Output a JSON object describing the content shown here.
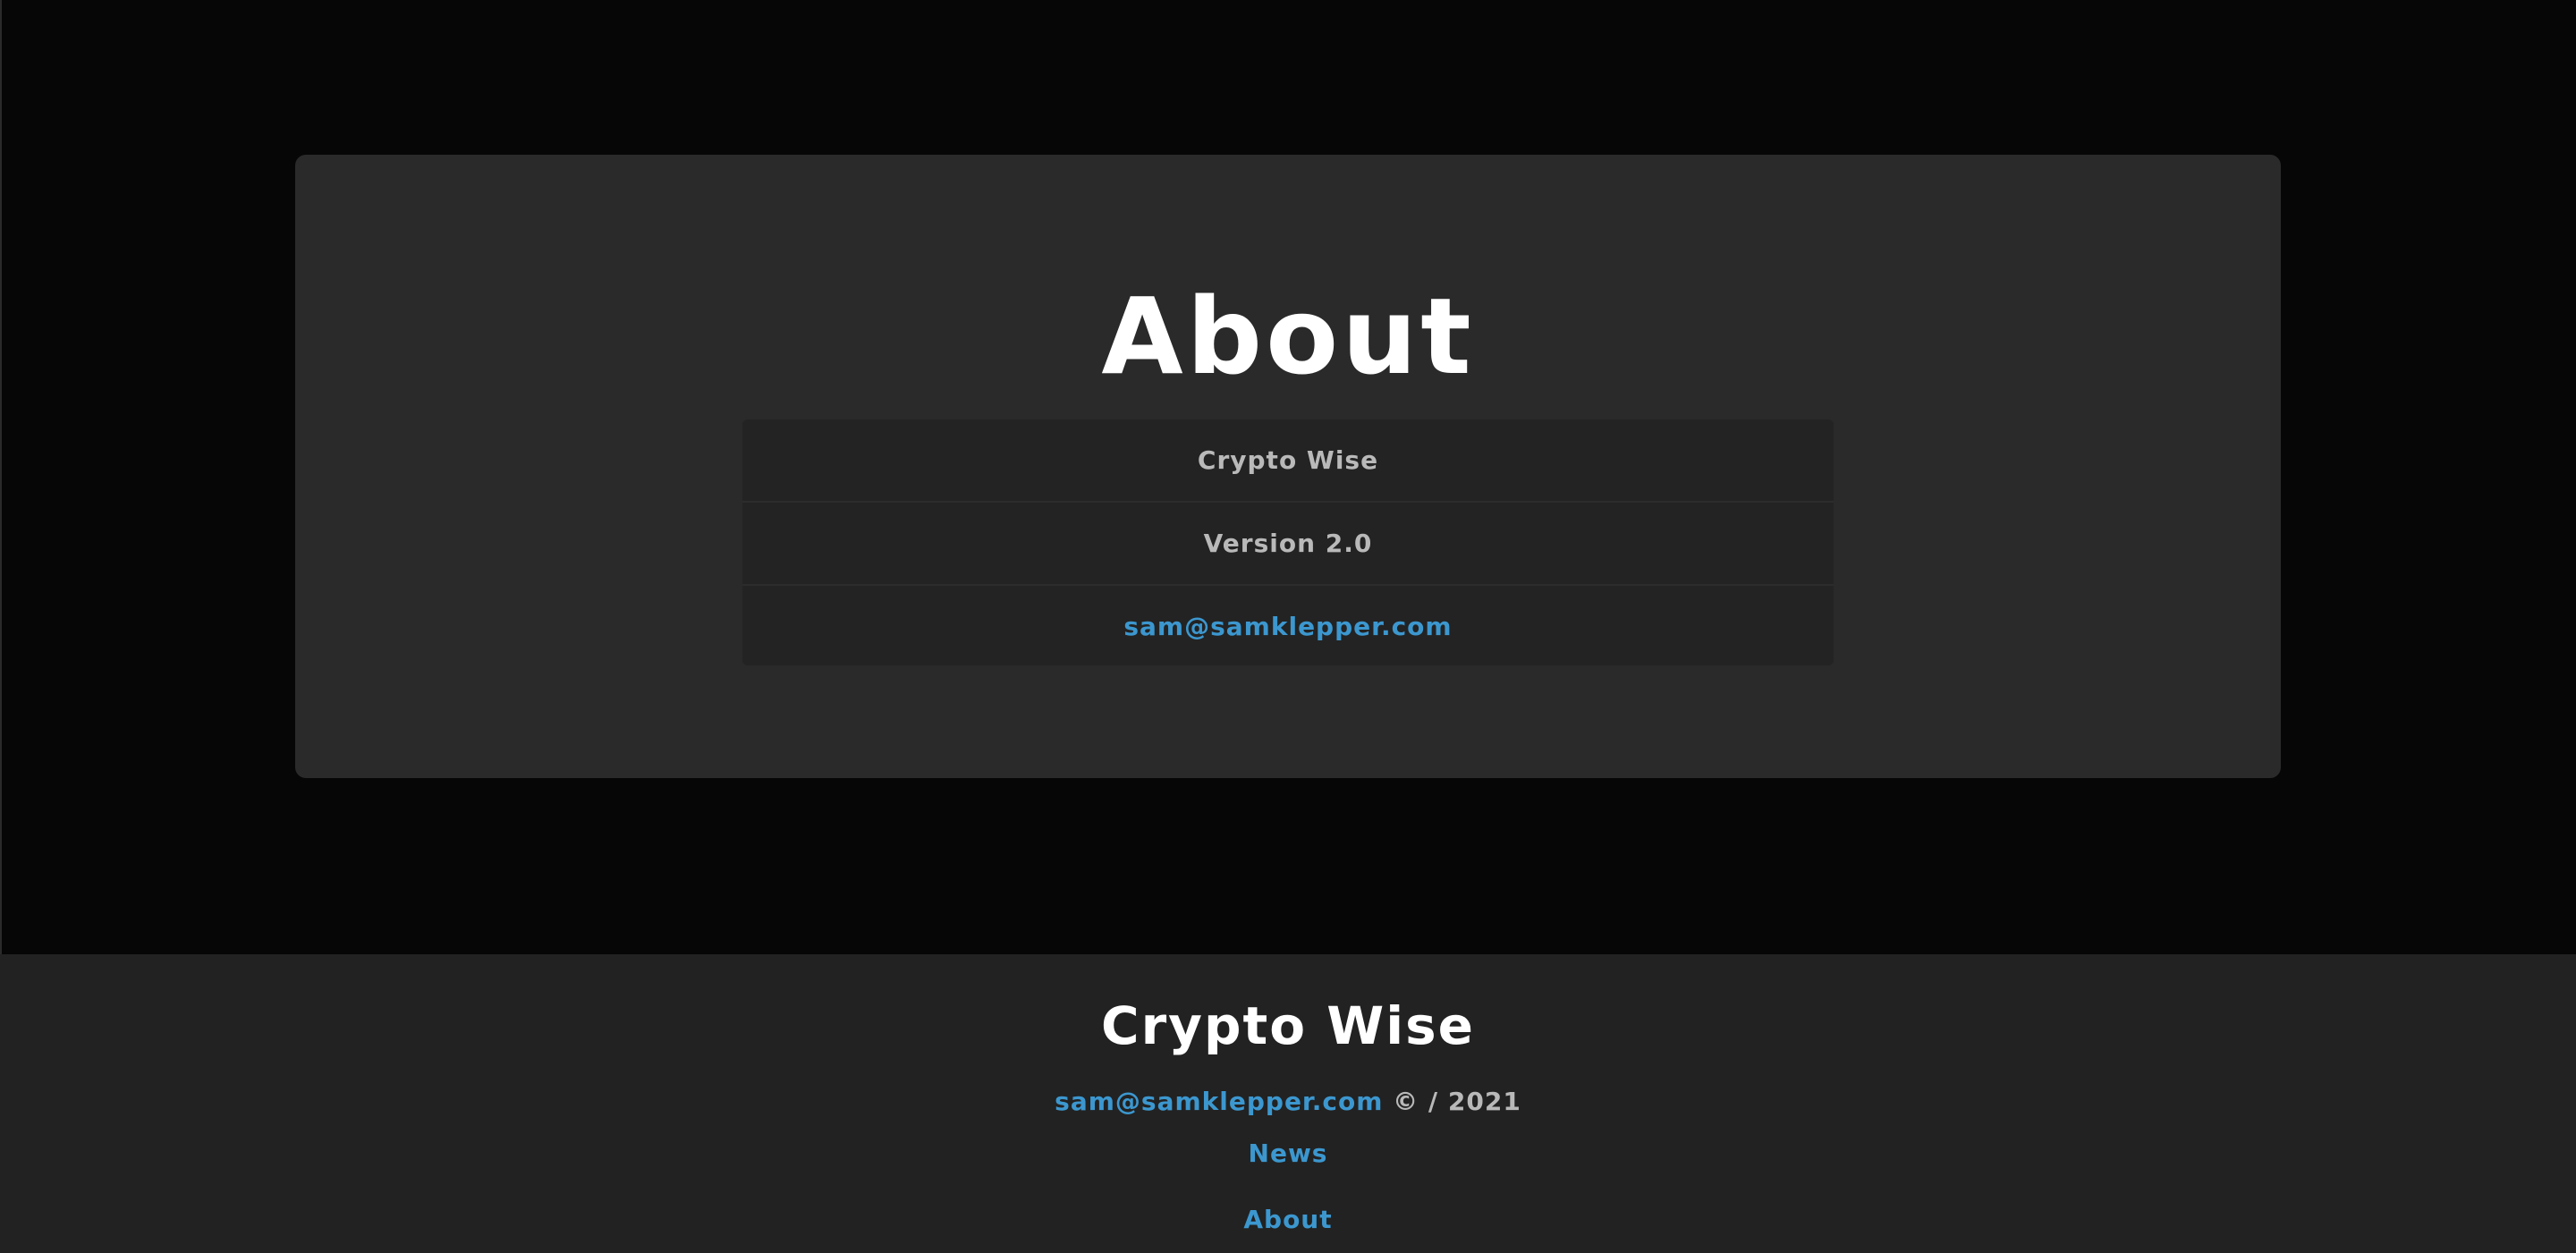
{
  "main": {
    "title": "About",
    "info_rows": [
      {
        "text": "Crypto Wise"
      },
      {
        "text": "Version 2.0"
      },
      {
        "text": "sam@samklepper.com"
      }
    ]
  },
  "footer": {
    "brand": "Crypto Wise",
    "email": "sam@samklepper.com",
    "copyright": "© / 2021",
    "nav": {
      "news": "News",
      "about": "About"
    }
  },
  "colors": {
    "background": "#060606",
    "card": "#2a2a2a",
    "list": "#232323",
    "footer": "#222222",
    "link": "#3c97cf",
    "muted_text": "#b9b9b9",
    "heading": "#ffffff"
  }
}
